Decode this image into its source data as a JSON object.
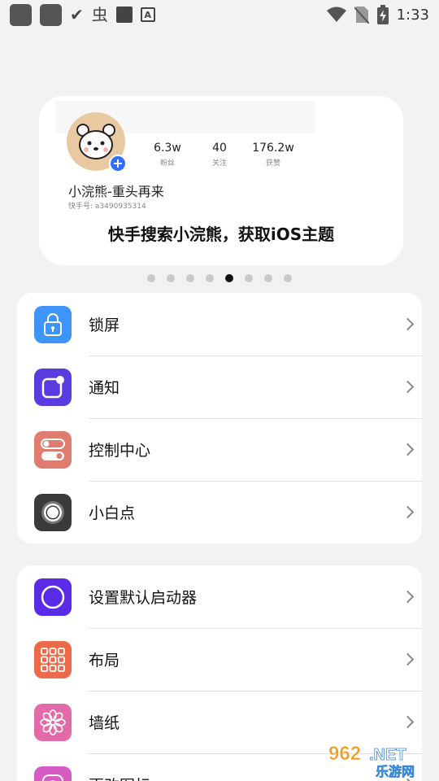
{
  "status_bar": {
    "time": "1:33"
  },
  "banner": {
    "stats": [
      {
        "value": "6.3w",
        "label": "粉丝"
      },
      {
        "value": "40",
        "label": "关注"
      },
      {
        "value": "176.2w",
        "label": "获赞"
      }
    ],
    "user_name": "小浣熊-重头再来",
    "user_id": "快手号: a3490935314",
    "slogan": "快手搜索小浣熊，获取iOS主题"
  },
  "pager": {
    "count": 8,
    "active_index": 4
  },
  "menu_group_1": [
    {
      "label": "锁屏",
      "icon": "lock-icon",
      "color": "#3d95f7"
    },
    {
      "label": "通知",
      "icon": "notification-icon",
      "color": "#5a3be0"
    },
    {
      "label": "控制中心",
      "icon": "toggle-icon",
      "color": "#e07b70"
    },
    {
      "label": "小白点",
      "icon": "assistive-touch-icon",
      "color": "#3a3a3a"
    }
  ],
  "menu_group_2": [
    {
      "label": "设置默认启动器",
      "icon": "launcher-icon",
      "color": "#5a2be6"
    },
    {
      "label": "布局",
      "icon": "grid-icon",
      "color": "#ec6a4a"
    },
    {
      "label": "墙纸",
      "icon": "flower-icon",
      "color": "#e36aa8"
    },
    {
      "label": "更改图标",
      "icon": "change-icon-icon",
      "color": "#d65bc4"
    }
  ],
  "watermark": {
    "text_top": "962.NET",
    "text_bottom": "乐游网"
  }
}
